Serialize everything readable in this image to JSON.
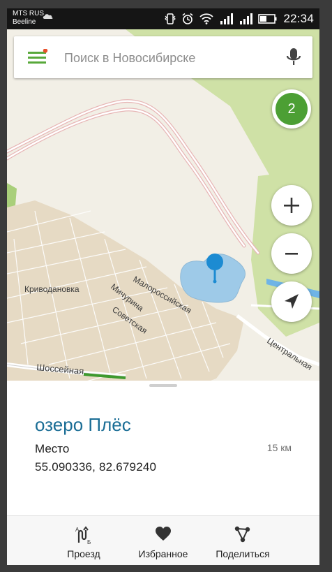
{
  "status_bar": {
    "carrier_line1": "MTS RUS",
    "carrier_line2": "Beeline",
    "time": "22:34",
    "icons": [
      "cloud-icon",
      "vibrate-icon",
      "alarm-icon",
      "wifi-icon",
      "signal-icon",
      "signal-icon",
      "battery-icon"
    ]
  },
  "search": {
    "placeholder": "Поиск в Новосибирске",
    "menu_icon": "hamburger-menu-icon",
    "mic_icon": "microphone-icon"
  },
  "map": {
    "badge_count": "2",
    "labels": {
      "village": "Криводановка",
      "street_1": "Малороссийская",
      "street_2": "Мичурина",
      "street_3": "Советская",
      "street_4": "Шоссейная",
      "street_5": "Центральная"
    },
    "controls": [
      "zoom-in-icon",
      "zoom-out-icon",
      "locate-icon"
    ],
    "colors": {
      "land": "#f2efe6",
      "residential": "#e8dcc8",
      "park": "#cfe1a6",
      "water": "#9ecae8",
      "pin": "#1c8bd2"
    }
  },
  "place": {
    "name": "озеро Плёс",
    "type": "Место",
    "distance": "15 км",
    "coordinates": "55.090336, 82.679240"
  },
  "actions": [
    {
      "label": "Проезд",
      "icon": "route-icon"
    },
    {
      "label": "Избранное",
      "icon": "heart-icon"
    },
    {
      "label": "Поделиться",
      "icon": "share-icon"
    }
  ]
}
